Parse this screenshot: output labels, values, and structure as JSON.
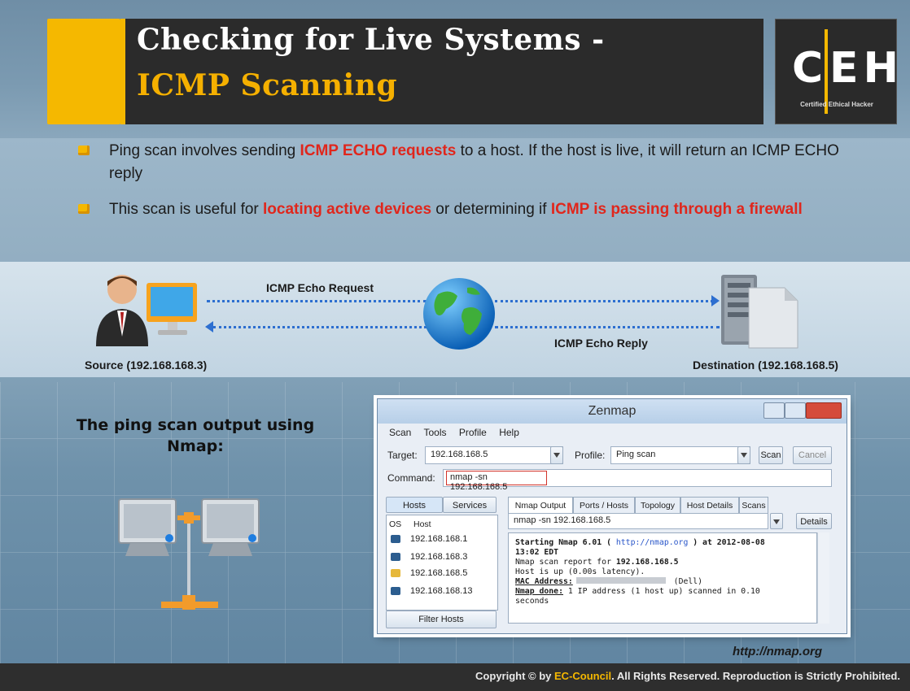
{
  "header": {
    "title_line1": "Checking for Live Systems -",
    "title_line2": "ICMP Scanning",
    "logo_text_c": "C",
    "logo_text_eh": "EH",
    "logo_subtitle": "Certified   Ethical   Hacker"
  },
  "bullets": [
    {
      "pre": "Ping scan involves sending ",
      "hl1": "ICMP ECHO requests",
      "mid": " to a host. If the host is live, it will return an ICMP ECHO reply",
      "hl2": "",
      "post": ""
    },
    {
      "pre": "This scan is useful for ",
      "hl1": "locating active devices",
      "mid": " or determining if ",
      "hl2": "ICMP is passing through a firewall",
      "post": ""
    }
  ],
  "diagram": {
    "request_label": "ICMP Echo Request",
    "reply_label": "ICMP Echo Reply",
    "source_label": "Source (192.168.168.3)",
    "destination_label": "Destination (192.168.168.5)"
  },
  "caption": "The ping scan output using Nmap:",
  "zenmap": {
    "window_title": "Zenmap",
    "menu": [
      "Scan",
      "Tools",
      "Profile",
      "Help"
    ],
    "target_label": "Target:",
    "target_value": "192.168.168.5",
    "profile_label": "Profile:",
    "profile_value": "Ping scan",
    "scan_button": "Scan",
    "cancel_button": "Cancel",
    "command_label": "Command:",
    "command_value": "nmap -sn 192.168.168.5",
    "left_tabs": [
      "Hosts",
      "Services"
    ],
    "host_header_os": "OS",
    "host_header_host": "Host",
    "hosts": [
      "192.168.168.1",
      "192.168.168.3",
      "192.168.168.5",
      "192.168.168.13"
    ],
    "filter_button": "Filter Hosts",
    "right_tabs": [
      "Nmap Output",
      "Ports / Hosts",
      "Topology",
      "Host Details",
      "Scans"
    ],
    "output_select_value": "nmap -sn 192.168.168.5",
    "details_button": "Details",
    "output_lines": {
      "l1a": "Starting Nmap 6.01 ( ",
      "l1link": "http://nmap.org",
      "l1b": " ) at 2012-08-08",
      "l2": "13:02 EDT",
      "l3a": "Nmap scan report for ",
      "l3b": "192.168.168.5",
      "l4": "Host is up (0.00s latency).",
      "l5a": "MAC Address:",
      "l5b": " (Dell)",
      "l6a": "Nmap done:",
      "l6b": " 1 IP address (1 host up) scanned in 0.10",
      "l7": "seconds"
    }
  },
  "footer": {
    "url": "http://nmap.org",
    "copyright_pre": "Copyright © by ",
    "copyright_brand": "EC-Council",
    "copyright_post": ". All Rights Reserved. Reproduction is Strictly Prohibited."
  }
}
